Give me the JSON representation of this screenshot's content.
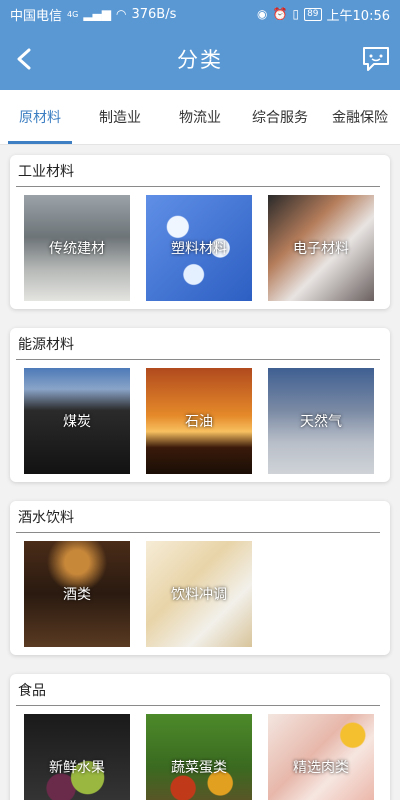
{
  "statusbar": {
    "carrier": "中国电信",
    "network": "4G",
    "speed": "376B/s",
    "battery": "89",
    "time": "上午10:56"
  },
  "header": {
    "title": "分类",
    "back_icon": "back-arrow-icon",
    "message_icon": "message-icon"
  },
  "tabs": [
    {
      "label": "原材料",
      "active": true
    },
    {
      "label": "制造业",
      "active": false
    },
    {
      "label": "物流业",
      "active": false
    },
    {
      "label": "综合服务",
      "active": false
    },
    {
      "label": "金融保险",
      "active": false
    }
  ],
  "sections": [
    {
      "title": "工业材料",
      "items": [
        {
          "label": "传统建材"
        },
        {
          "label": "塑料材料"
        },
        {
          "label": "电子材料"
        }
      ]
    },
    {
      "title": "能源材料",
      "items": [
        {
          "label": "煤炭"
        },
        {
          "label": "石油"
        },
        {
          "label": "天然气"
        }
      ]
    },
    {
      "title": "酒水饮料",
      "items": [
        {
          "label": "酒类"
        },
        {
          "label": "饮料冲调"
        }
      ]
    },
    {
      "title": "食品",
      "items": [
        {
          "label": "新鲜水果"
        },
        {
          "label": "蔬菜蛋类"
        },
        {
          "label": "精选肉类"
        }
      ]
    }
  ],
  "colors": {
    "primary": "#5a98d4",
    "active_tab": "#3d7fc2"
  }
}
